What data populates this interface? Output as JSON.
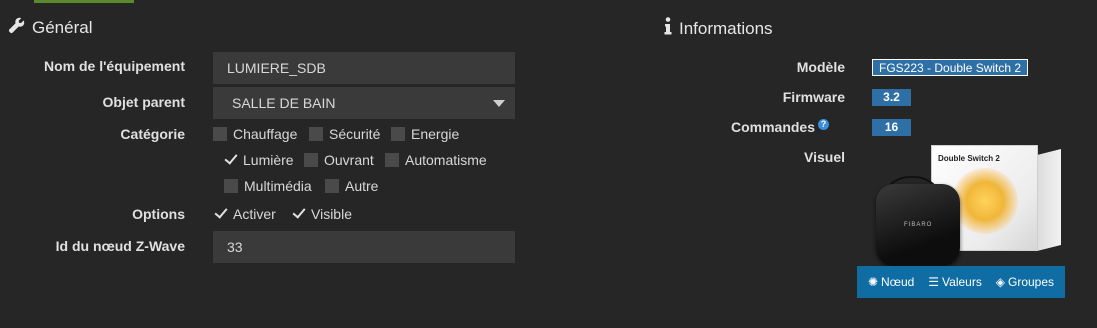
{
  "general": {
    "title": "Général",
    "labels": {
      "name": "Nom de l'équipement",
      "parent": "Objet parent",
      "category": "Catégorie",
      "options": "Options",
      "node_id": "Id du nœud Z-Wave"
    },
    "name_value": "LUMIERE_SDB",
    "parent_value": "SALLE DE BAIN",
    "categories": [
      {
        "label": "Chauffage",
        "checked": false
      },
      {
        "label": "Sécurité",
        "checked": false
      },
      {
        "label": "Energie",
        "checked": false
      },
      {
        "label": "Lumière",
        "checked": true
      },
      {
        "label": "Ouvrant",
        "checked": false
      },
      {
        "label": "Automatisme",
        "checked": false
      },
      {
        "label": "Multimédia",
        "checked": false
      },
      {
        "label": "Autre",
        "checked": false
      }
    ],
    "options": [
      {
        "label": "Activer",
        "checked": true
      },
      {
        "label": "Visible",
        "checked": true
      }
    ],
    "node_id_value": "33"
  },
  "info": {
    "title": "Informations",
    "labels": {
      "model": "Modèle",
      "firmware": "Firmware",
      "commands": "Commandes",
      "visual": "Visuel"
    },
    "model_value": "FGS223 - Double Switch 2",
    "firmware_value": "3.2",
    "commands_value": "16",
    "product_box_title": "Double Switch 2",
    "tabs": [
      {
        "label": "Nœud",
        "icon": "node-icon"
      },
      {
        "label": "Valeurs",
        "icon": "list-icon"
      },
      {
        "label": "Groupes",
        "icon": "layers-icon"
      }
    ]
  },
  "colors": {
    "background": "#262626",
    "field": "#3a3a3a",
    "badge": "#2e6fa6",
    "tabbar": "#0f6da3"
  }
}
